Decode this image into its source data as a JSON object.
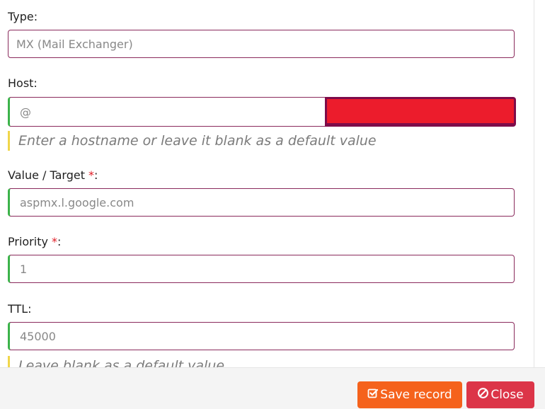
{
  "form": {
    "type": {
      "label": "Type:",
      "value": "MX (Mail Exchanger)"
    },
    "host": {
      "label": "Host:",
      "value": "@",
      "hint": "Enter a hostname or leave it blank as a default value"
    },
    "value_target": {
      "label": "Value / Target",
      "required_mark": "*",
      "colon": ":",
      "value": "aspmx.l.google.com"
    },
    "priority": {
      "label": "Priority",
      "required_mark": "*",
      "colon": ":",
      "value": "1"
    },
    "ttl": {
      "label": "TTL:",
      "value": "45000",
      "hint": "Leave blank as a default value"
    }
  },
  "footer": {
    "save_label": "Save record",
    "close_label": "Close"
  },
  "colors": {
    "save_button": "#f5621c",
    "close_button": "#dc3548",
    "valid_border": "#3cb34a",
    "field_border": "#8a2a5c",
    "hint_bar": "#f0d64a",
    "host_suffix_redacted": "#ec1c2c"
  },
  "icons": {
    "save": "check-square-icon",
    "close": "ban-icon"
  }
}
